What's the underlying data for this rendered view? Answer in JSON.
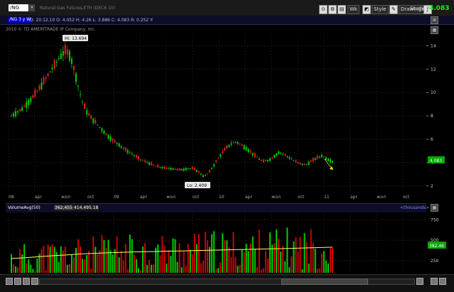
{
  "toolbar": {
    "symbol": "/NG",
    "symbol_description": "Natural Gas Futures,ETH (DEC6 10)",
    "wk_label": "Wk",
    "style_label": "Style",
    "drawings_label": "Drawings",
    "studies_label": "Studies",
    "last_price": "4.083"
  },
  "info_bar": {
    "series_tag": "/NG 3 y W",
    "ohlc": "D: 20.12.10   O: 4.052   H: 4.26   L: 3.886   C: 4.083   R: 0.252   Y:"
  },
  "copyright": "2010 © TD AMERITRADE IP Company, Inc.",
  "chart_data": [
    {
      "type": "candlestick",
      "title": "",
      "y_axis_labels": [
        "14",
        "12",
        "10",
        "8",
        "6",
        "4",
        "2"
      ],
      "x_axis_labels": [
        "08",
        "apr",
        "жол",
        "oct",
        "09",
        "apr",
        "жол",
        "oct",
        "10",
        "apr",
        "жол",
        "oct",
        "11",
        "apr",
        "жол",
        "oct"
      ],
      "high_label": "Hi: 13.694",
      "low_label": "Lo: 2.409",
      "current_price_tag": "4.083",
      "ylim": [
        1.5,
        15
      ],
      "close_series_approx": [
        8.0,
        8.3,
        8.6,
        9.1,
        9.6,
        10.2,
        10.9,
        11.6,
        12.3,
        13.0,
        13.6,
        13.2,
        11.5,
        9.6,
        8.4,
        7.8,
        7.3,
        6.8,
        6.3,
        5.9,
        5.6,
        5.2,
        4.9,
        4.6,
        4.3,
        4.1,
        3.9,
        3.7,
        3.6,
        3.5,
        3.5,
        3.4,
        3.4,
        3.5,
        3.5,
        3.2,
        2.8,
        3.2,
        3.9,
        4.6,
        5.2,
        5.6,
        5.8,
        5.5,
        5.2,
        4.8,
        4.4,
        4.1,
        4.2,
        4.5,
        4.9,
        4.7,
        4.4,
        4.1,
        3.9,
        3.8,
        4.1,
        4.4,
        4.6,
        4.3,
        4.1
      ]
    },
    {
      "type": "bar",
      "title": "",
      "series_label": "VolumeAvg(50)",
      "value_1": "362,455",
      "value_2": "414,495.18",
      "units_label": "<thousands>",
      "y_axis_labels": [
        "750",
        "500",
        "250"
      ],
      "current_avg_tag": "382.46",
      "ylim": [
        100,
        850
      ],
      "avg_series_approx": [
        275,
        285,
        298,
        310,
        320,
        332,
        340,
        347,
        352,
        357,
        361,
        365,
        368,
        372,
        376,
        380,
        384,
        388,
        392,
        396,
        400,
        405,
        410,
        415
      ],
      "colors": {
        "up": "#00cc00",
        "down": "#cc0000",
        "avg": "#ffff66"
      }
    }
  ]
}
